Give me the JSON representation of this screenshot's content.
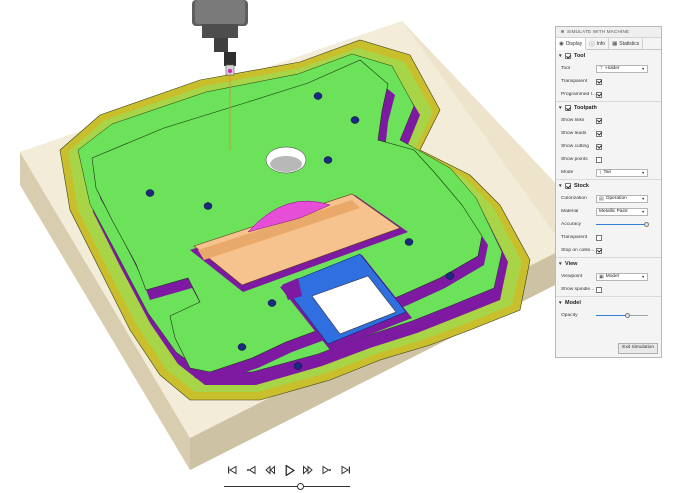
{
  "colors": {
    "stock_base": "#efe6cf",
    "stock_side": "#d9cfb2",
    "part_green": "#6be25a",
    "wall_purple": "#7d1aa1",
    "wall_yellow": "#c9bf2c",
    "pocket_tan": "#f6c38e",
    "pocket_blue": "#2f6fe0",
    "hole_navy": "#1b2a7e",
    "magenta": "#e64ed8",
    "tool_gray": "#6e6e6e",
    "accent_blue": "#2f7fd6"
  },
  "panel": {
    "title": "SIMULATE WITH MACHINE",
    "tabs": [
      {
        "label": "Display",
        "icon": "eye-icon",
        "active": true
      },
      {
        "label": "Info",
        "icon": "info-icon",
        "active": false
      },
      {
        "label": "Statistics",
        "icon": "statistics-icon",
        "active": false
      }
    ],
    "tool": {
      "header": "Tool",
      "tool_label": "Tool",
      "tool_value": "Holder",
      "transparent_label": "Transparent",
      "programmed_label": "Programmed I..."
    },
    "toolpath": {
      "header": "Toolpath",
      "show_links": "Show links",
      "show_leads": "Show leads",
      "show_cutting": "Show cutting",
      "show_points": "Show points",
      "mode_label": "Mode",
      "mode_value": "Tail"
    },
    "stock": {
      "header": "Stock",
      "colorization_label": "Colorization",
      "colorization_value": "Operation",
      "material_label": "Material",
      "material_value": "Metallic Paint",
      "accuracy_label": "Accuracy",
      "accuracy_value": 0.98,
      "transparent_label": "Transparent",
      "stop_label": "Stop on collis..."
    },
    "view": {
      "header": "View",
      "viewpoint_label": "Viewpoint",
      "viewpoint_value": "Model",
      "spindle_label": "Show spindle..."
    },
    "model": {
      "header": "Model",
      "opacity_label": "Opacity",
      "opacity_value": 0.6
    },
    "exit_label": "Exit Simulation"
  },
  "playback": {
    "buttons": [
      "go-to-start",
      "previous-operation",
      "step-back",
      "play",
      "step-forward",
      "next-operation",
      "go-to-end"
    ],
    "progress": 0.6
  }
}
